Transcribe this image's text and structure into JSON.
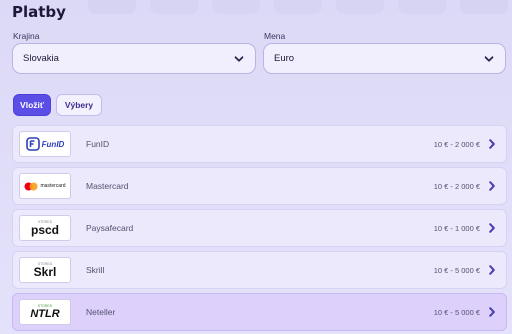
{
  "header": {
    "title": "Platby"
  },
  "country": {
    "label": "Krajina",
    "value": "Slovakia"
  },
  "currency": {
    "label": "Mena",
    "value": "Euro"
  },
  "tabs": [
    {
      "label": "Vložiť",
      "active": true
    },
    {
      "label": "Výbery",
      "active": false
    }
  ],
  "methods": [
    {
      "name": "FunID",
      "range": "10 € - 2 000 €",
      "logo_text": "FunID",
      "icon": "funid-logo"
    },
    {
      "name": "Mastercard",
      "range": "10 € - 2 000 €",
      "logo_text": "mastercard",
      "icon": "mastercard-logo"
    },
    {
      "name": "Paysafecard",
      "range": "10 € - 1 000 €",
      "logo_text": "pscd",
      "logo_badge": "STORED",
      "icon": "paysafecard-logo"
    },
    {
      "name": "Skrill",
      "range": "10 € - 5 000 €",
      "logo_text": "Skrl",
      "logo_badge": "STORED",
      "icon": "skrill-logo"
    },
    {
      "name": "Neteller",
      "range": "10 € - 5 000 €",
      "logo_text": "NTLR",
      "logo_badge": "STORED",
      "icon": "neteller-logo",
      "highlighted": true
    }
  ],
  "colors": {
    "accent": "#5b4ee6",
    "background": "#dcd9f6",
    "row": "#ece9fc",
    "row_highlight": "#ddd1fb",
    "text": "#1d1838"
  }
}
